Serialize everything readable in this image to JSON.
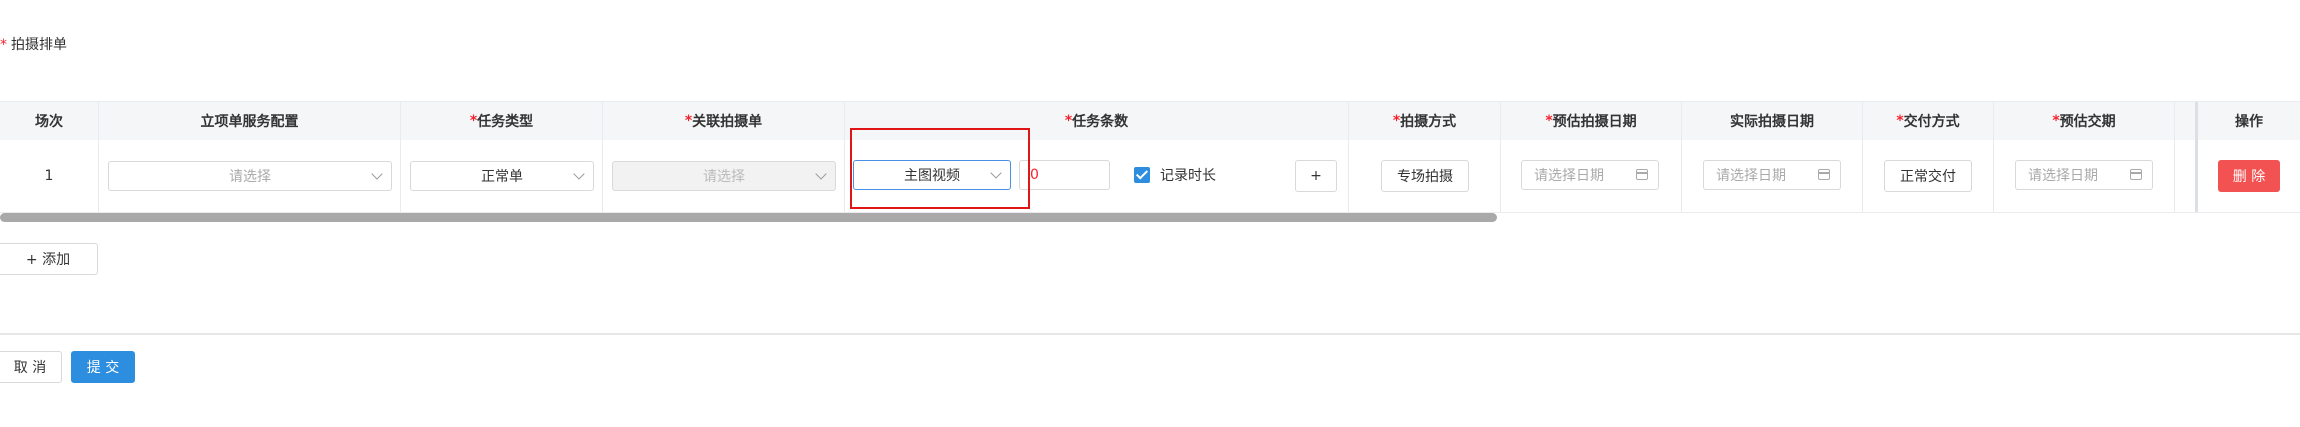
{
  "section": {
    "required_mark": "*",
    "label": "拍摄排单"
  },
  "table": {
    "headers": [
      {
        "label": "场次",
        "required": false
      },
      {
        "label": "立项单服务配置",
        "required": false
      },
      {
        "label": "任务类型",
        "required": true
      },
      {
        "label": "关联拍摄单",
        "required": true
      },
      {
        "label": "任务条数",
        "required": true
      },
      {
        "label": "拍摄方式",
        "required": true
      },
      {
        "label": "预估拍摄日期",
        "required": true
      },
      {
        "label": "实际拍摄日期",
        "required": false
      },
      {
        "label": "交付方式",
        "required": true
      },
      {
        "label": "预估交期",
        "required": true
      },
      {
        "label": "",
        "required": false
      },
      {
        "label": "操作",
        "required": false
      }
    ],
    "required_mark": "*",
    "row": {
      "index": "1",
      "service_config_placeholder": "请选择",
      "task_type": "正常单",
      "related_shoot_placeholder": "请选择",
      "task_video_type": "主图视频",
      "task_count": "0",
      "record_duration_label": "记录时长",
      "record_duration_checked": true,
      "plus_label": "+",
      "shoot_method": "专场拍摄",
      "est_shoot_date_placeholder": "请选择日期",
      "actual_shoot_date_placeholder": "请选择日期",
      "delivery_method": "正常交付",
      "est_delivery_placeholder": "请选择日期",
      "delete_label": "删 除"
    }
  },
  "add_label": "+ 添加",
  "footer": {
    "cancel_label": "取 消",
    "submit_label": "提 交"
  },
  "colors": {
    "primary": "#2d8ee0",
    "danger": "#f25252",
    "required": "#f5222d",
    "highlight": "#e01616"
  }
}
